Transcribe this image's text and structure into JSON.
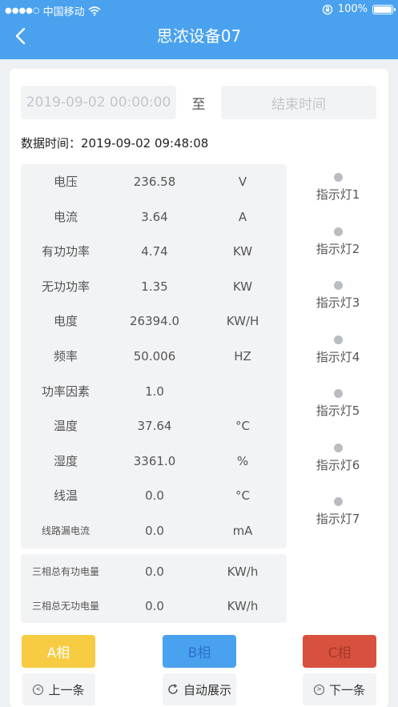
{
  "statusbar": {
    "carrier": "中国移动",
    "battery": "100%"
  },
  "header": {
    "title": "思浓设备07"
  },
  "filter": {
    "start_value": "2019-09-02 00:00:00",
    "separator": "至",
    "end_placeholder": "结束时间"
  },
  "data_time": "数据时间：2019-09-02 09:48:08",
  "metrics": [
    {
      "label": "电压",
      "value": "236.58",
      "unit": "V"
    },
    {
      "label": "电流",
      "value": "3.64",
      "unit": "A"
    },
    {
      "label": "有功功率",
      "value": "4.74",
      "unit": "KW"
    },
    {
      "label": "无功功率",
      "value": "1.35",
      "unit": "KW"
    },
    {
      "label": "电度",
      "value": "26394.0",
      "unit": "KW/H"
    },
    {
      "label": "频率",
      "value": "50.006",
      "unit": "HZ"
    },
    {
      "label": "功率因素",
      "value": "1.0",
      "unit": ""
    },
    {
      "label": "温度",
      "value": "37.64",
      "unit": "°C"
    },
    {
      "label": "湿度",
      "value": "3361.0",
      "unit": "%"
    },
    {
      "label": "线温",
      "value": "0.0",
      "unit": "°C"
    },
    {
      "label": "线路漏电流",
      "value": "0.0",
      "unit": "mA"
    }
  ],
  "totals": [
    {
      "label": "三相总有功电量",
      "value": "0.0",
      "unit": "KW/h"
    },
    {
      "label": "三相总无功电量",
      "value": "0.0",
      "unit": "KW/h"
    }
  ],
  "indicators": [
    "指示灯1",
    "指示灯2",
    "指示灯3",
    "指示灯4",
    "指示灯5",
    "指示灯6",
    "指示灯7"
  ],
  "phases": {
    "a": "A相",
    "b": "B相",
    "c": "C相"
  },
  "nav": {
    "prev": "上一条",
    "auto": "自动展示",
    "next": "下一条"
  },
  "colors": {
    "header": "#4aa2ef",
    "phase_a": "#f7cc42",
    "phase_b": "#4aa2ef",
    "phase_c": "#d8513f",
    "indicator_off": "#b9bcc0"
  }
}
